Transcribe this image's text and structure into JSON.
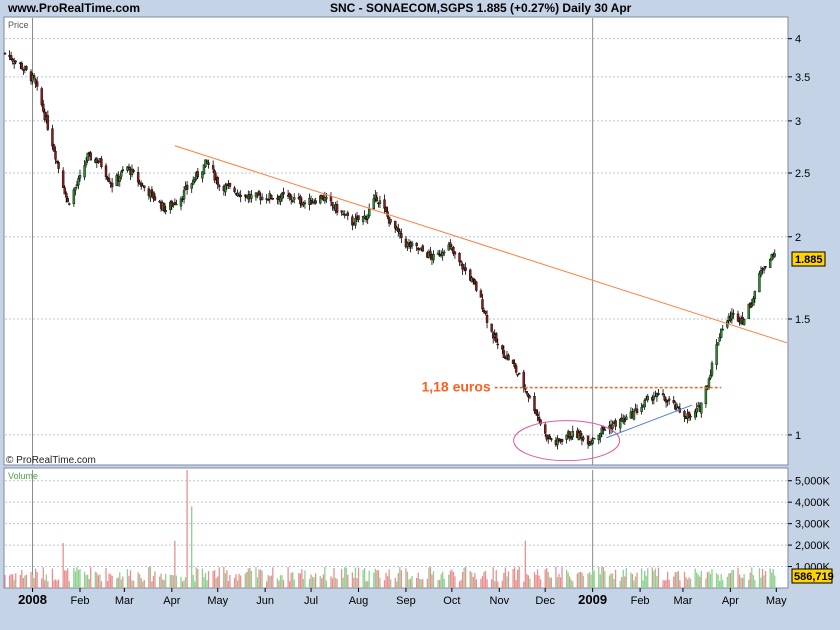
{
  "header": {
    "site": "www.ProRealTime.com",
    "title": "SNC - SONAECOM,SGPS    1.885 (+0.27%)    Daily  30 Apr"
  },
  "price_panel": {
    "label": "Price",
    "watermark": "© ProRealTime.com",
    "last_price_badge": "1.885",
    "annotation": "1,18 euros",
    "colors": {
      "up": "#2e8b2e",
      "down": "#8b1a1a",
      "trendline": "#ff7f3f",
      "support": "#ff6020",
      "ellipse": "#e05aa0",
      "minor_line": "#4a7fd0",
      "background": "#ffffff"
    }
  },
  "volume_panel": {
    "label": "Volume",
    "last_volume_badge": "586,719",
    "colors": {
      "up": "#8fd08f",
      "down": "#e89090"
    }
  },
  "chart_data": [
    {
      "type": "candlestick",
      "title": "SNC - SONAECOM,SGPS",
      "ylabel": "Price",
      "y_scale": "log",
      "ylim": [
        0.9,
        4.3
      ],
      "y_ticks": [
        1,
        1.5,
        2,
        2.5,
        3,
        3.5,
        4
      ],
      "y_tick_labels": [
        "1",
        "1.5",
        "2",
        "2.5",
        "3",
        "3.5",
        "4"
      ],
      "x_tick_labels": [
        "2008",
        "Feb",
        "Mar",
        "Apr",
        "May",
        "Jun",
        "Jul",
        "Aug",
        "Sep",
        "Oct",
        "Nov",
        "Dec",
        "2009",
        "Feb",
        "Mar",
        "Apr",
        "May"
      ],
      "x_range": [
        "2007-12-14",
        "2009-05-08"
      ],
      "close_path": [
        [
          "2007-12-14",
          3.8
        ],
        [
          "2007-12-24",
          3.65
        ],
        [
          "2008-01-02",
          3.45
        ],
        [
          "2008-01-10",
          3.0
        ],
        [
          "2008-01-18",
          2.55
        ],
        [
          "2008-01-24",
          2.25
        ],
        [
          "2008-02-01",
          2.45
        ],
        [
          "2008-02-06",
          2.65
        ],
        [
          "2008-02-14",
          2.6
        ],
        [
          "2008-02-22",
          2.4
        ],
        [
          "2008-03-03",
          2.55
        ],
        [
          "2008-03-12",
          2.4
        ],
        [
          "2008-03-20",
          2.3
        ],
        [
          "2008-03-28",
          2.2
        ],
        [
          "2008-04-07",
          2.3
        ],
        [
          "2008-04-16",
          2.45
        ],
        [
          "2008-04-24",
          2.6
        ],
        [
          "2008-05-02",
          2.4
        ],
        [
          "2008-05-12",
          2.35
        ],
        [
          "2008-05-22",
          2.3
        ],
        [
          "2008-06-02",
          2.3
        ],
        [
          "2008-06-15",
          2.3
        ],
        [
          "2008-06-28",
          2.25
        ],
        [
          "2008-07-08",
          2.3
        ],
        [
          "2008-07-18",
          2.2
        ],
        [
          "2008-07-28",
          2.1
        ],
        [
          "2008-08-06",
          2.15
        ],
        [
          "2008-08-13",
          2.3
        ],
        [
          "2008-08-22",
          2.1
        ],
        [
          "2008-09-01",
          1.95
        ],
        [
          "2008-09-12",
          1.9
        ],
        [
          "2008-09-20",
          1.85
        ],
        [
          "2008-09-28",
          1.95
        ],
        [
          "2008-10-04",
          1.85
        ],
        [
          "2008-10-12",
          1.75
        ],
        [
          "2008-10-18",
          1.65
        ],
        [
          "2008-10-22",
          1.55
        ],
        [
          "2008-10-26",
          1.45
        ],
        [
          "2008-11-01",
          1.35
        ],
        [
          "2008-11-08",
          1.3
        ],
        [
          "2008-11-16",
          1.2
        ],
        [
          "2008-11-24",
          1.1
        ],
        [
          "2008-12-01",
          1.0
        ],
        [
          "2008-12-08",
          0.97
        ],
        [
          "2008-12-15",
          1.0
        ],
        [
          "2008-12-22",
          1.0
        ],
        [
          "2008-12-30",
          0.98
        ],
        [
          "2009-01-08",
          1.02
        ],
        [
          "2009-01-16",
          1.04
        ],
        [
          "2009-01-24",
          1.06
        ],
        [
          "2009-02-01",
          1.1
        ],
        [
          "2009-02-10",
          1.15
        ],
        [
          "2009-02-18",
          1.13
        ],
        [
          "2009-02-26",
          1.09
        ],
        [
          "2009-03-06",
          1.06
        ],
        [
          "2009-03-12",
          1.1
        ],
        [
          "2009-03-18",
          1.22
        ],
        [
          "2009-03-26",
          1.45
        ],
        [
          "2009-04-02",
          1.52
        ],
        [
          "2009-04-10",
          1.5
        ],
        [
          "2009-04-16",
          1.62
        ],
        [
          "2009-04-22",
          1.8
        ],
        [
          "2009-04-30",
          1.885
        ]
      ],
      "last": {
        "date": "2009-04-30",
        "close": 1.885,
        "change_pct": 0.27
      },
      "annotations": [
        {
          "type": "trendline",
          "from": [
            "2008-04-03",
            2.75
          ],
          "to": [
            "2009-05-08",
            1.38
          ]
        },
        {
          "type": "horizontal",
          "label": "1,18 euros",
          "y": 1.18,
          "from": "2008-10-29",
          "to": "2009-03-26"
        },
        {
          "type": "ellipse",
          "center": [
            "2008-12-15",
            0.98
          ]
        },
        {
          "type": "line",
          "from": [
            "2009-01-10",
            0.99
          ],
          "to": [
            "2009-03-07",
            1.11
          ]
        }
      ]
    },
    {
      "type": "bar",
      "title": "Volume",
      "ylim": [
        0,
        5500000
      ],
      "y_ticks": [
        1000000,
        2000000,
        3000000,
        4000000,
        5000000
      ],
      "y_tick_labels": [
        "1,000K",
        "2,000K",
        "3,000K",
        "4,000K",
        "5,000K"
      ],
      "typical_volume": [
        300000,
        1000000
      ],
      "notable_peaks": [
        {
          "date": "2008-01-21",
          "value": 2100000
        },
        {
          "date": "2008-04-03",
          "value": 2200000
        },
        {
          "date": "2008-04-11",
          "value": 5600000
        },
        {
          "date": "2008-04-14",
          "value": 3800000
        },
        {
          "date": "2008-11-18",
          "value": 2200000
        }
      ],
      "last": {
        "date": "2009-04-30",
        "value": 586719
      }
    }
  ]
}
